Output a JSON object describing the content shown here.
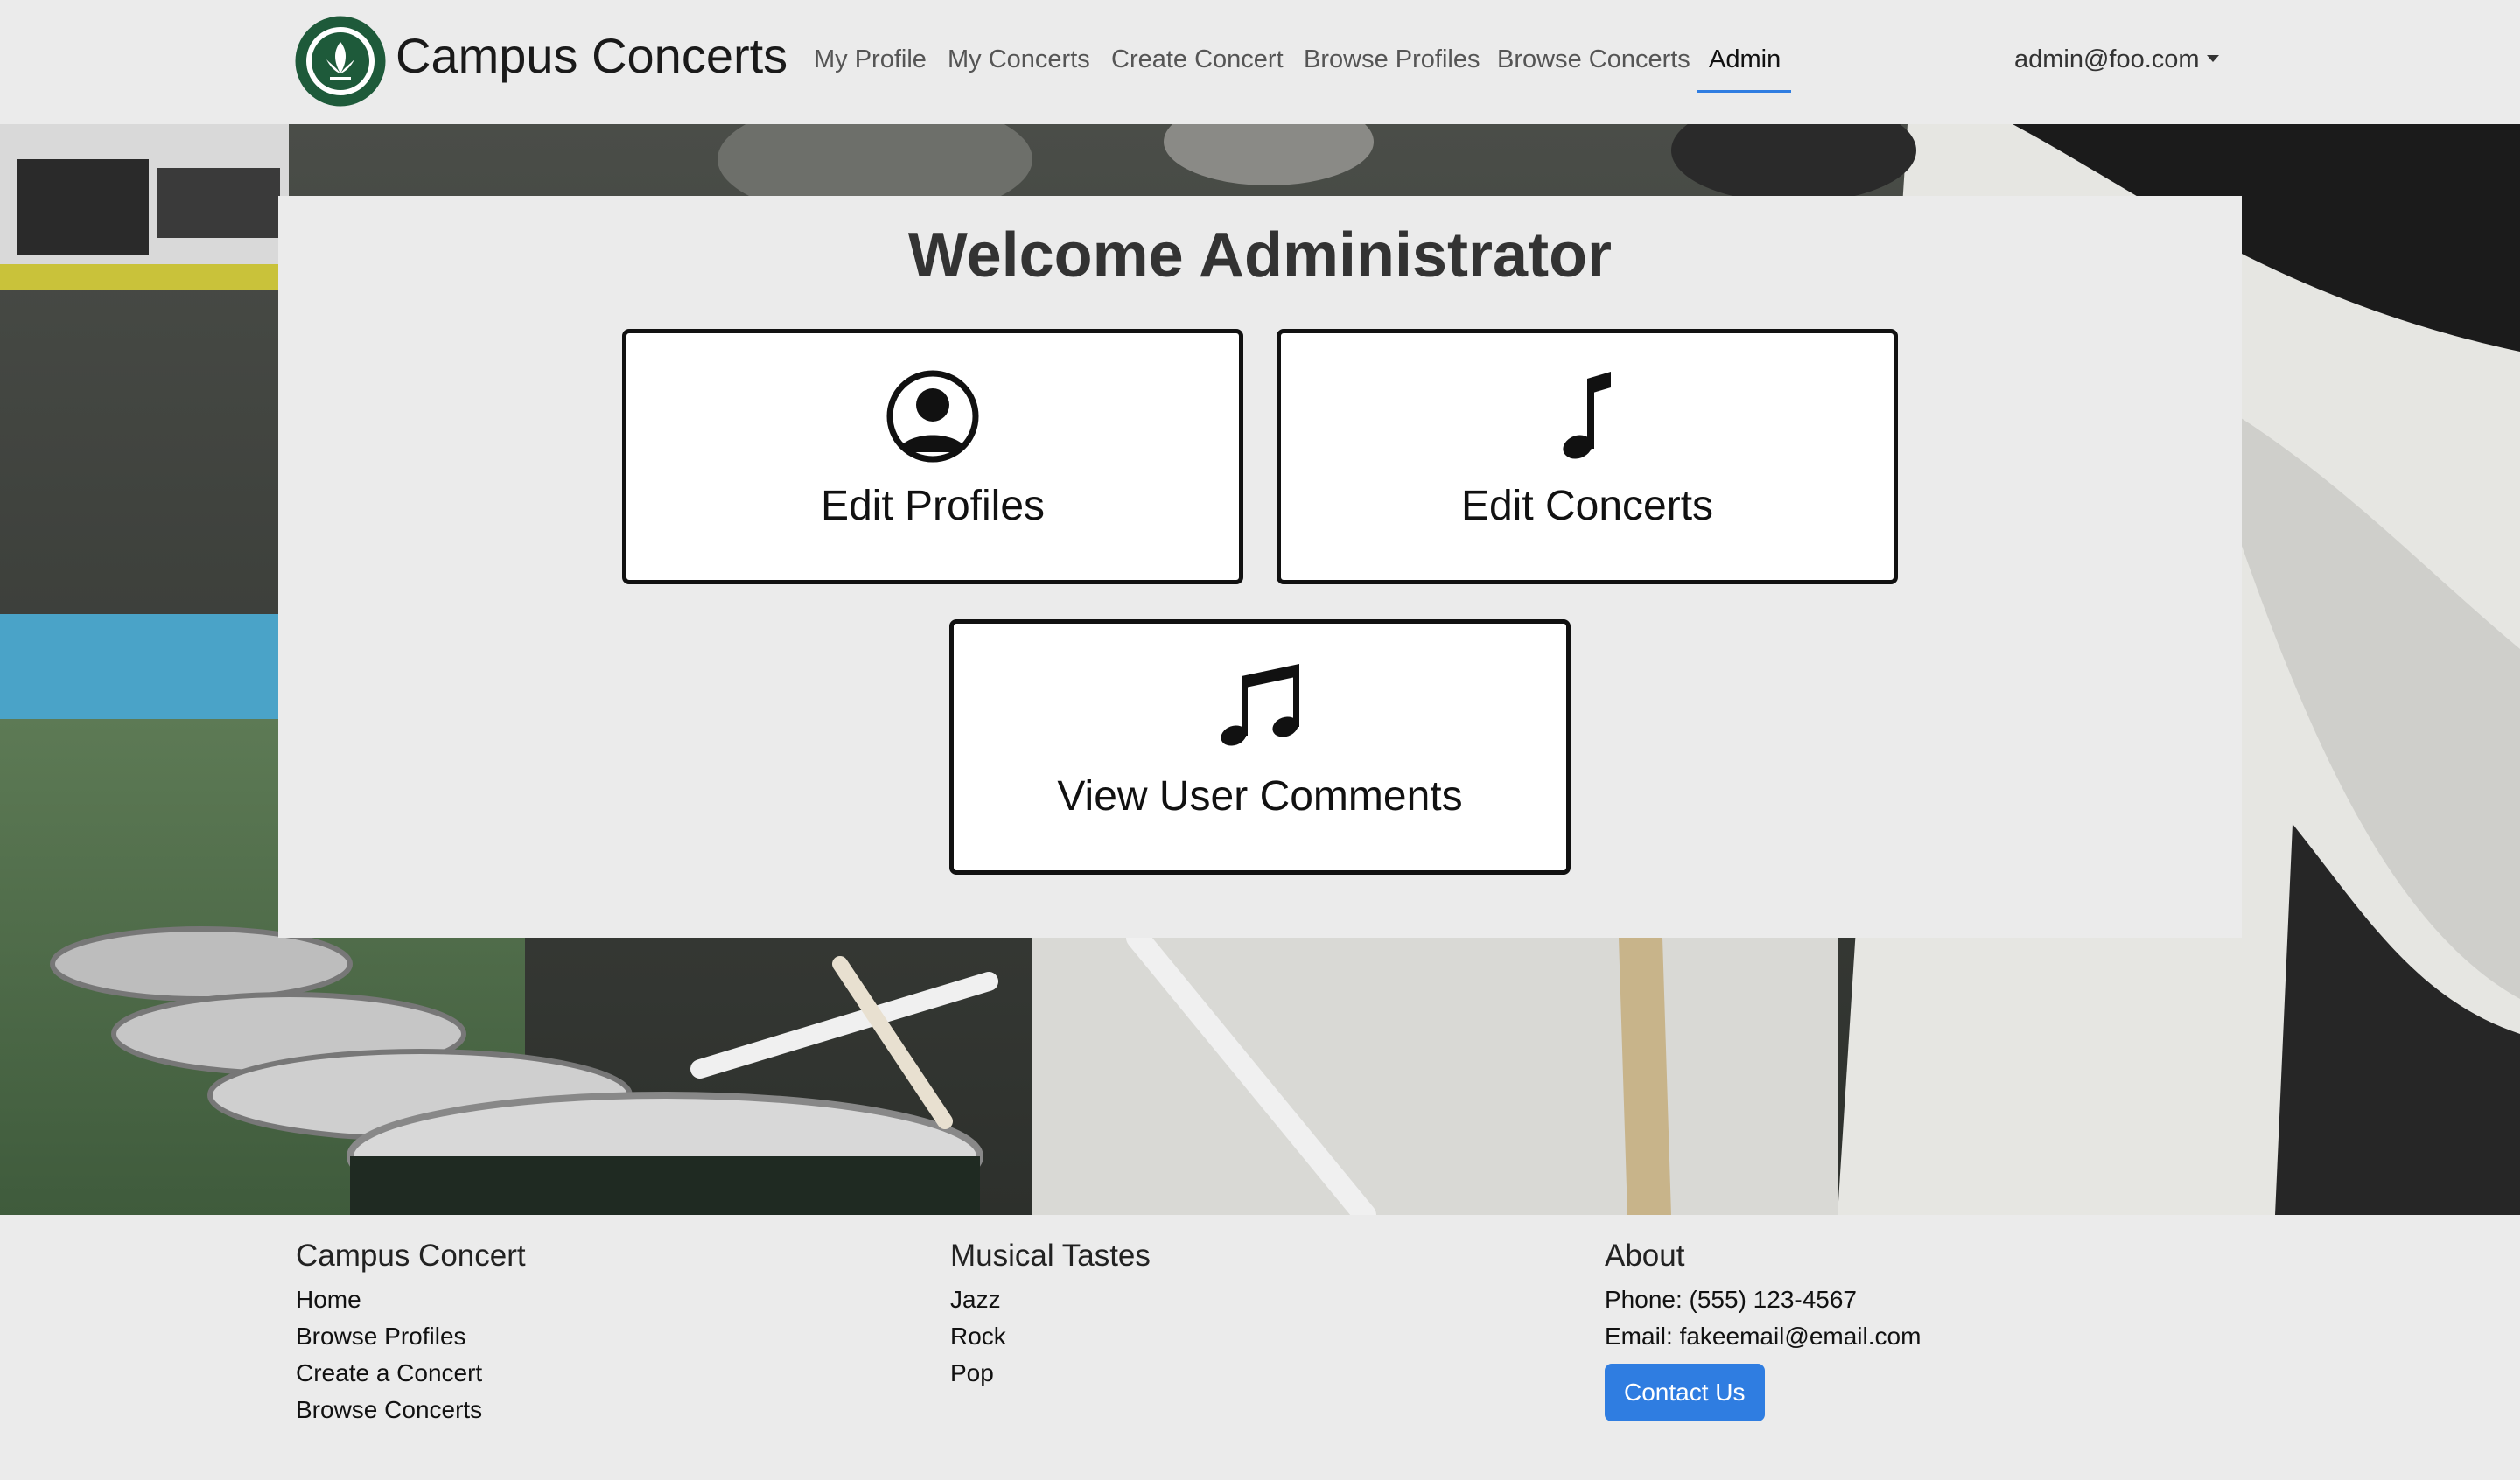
{
  "nav": {
    "brand": "Campus Concerts",
    "links": [
      "My Profile",
      "My Concerts",
      "Create Concert",
      "Browse Profiles",
      "Browse Concerts",
      "Admin"
    ],
    "active": "Admin",
    "user": "admin@foo.com"
  },
  "main": {
    "title": "Welcome Administrator",
    "cards": [
      {
        "label": "Edit Profiles",
        "icon": "person-circle-icon"
      },
      {
        "label": "Edit Concerts",
        "icon": "music-note-icon"
      },
      {
        "label": "View User Comments",
        "icon": "music-note-beamed-icon"
      }
    ]
  },
  "footer": {
    "col1": {
      "heading": "Campus Concert",
      "items": [
        "Home",
        "Browse Profiles",
        "Create a Concert",
        "Browse Concerts"
      ]
    },
    "col2": {
      "heading": "Musical Tastes",
      "items": [
        "Jazz",
        "Rock",
        "Pop"
      ]
    },
    "col3": {
      "heading": "About",
      "phone": "Phone: (555) 123-4567",
      "email": "Email: fakeemail@email.com",
      "button": "Contact Us"
    }
  },
  "colors": {
    "accent": "#2f7de1",
    "logo_green": "#1e5a3a"
  }
}
